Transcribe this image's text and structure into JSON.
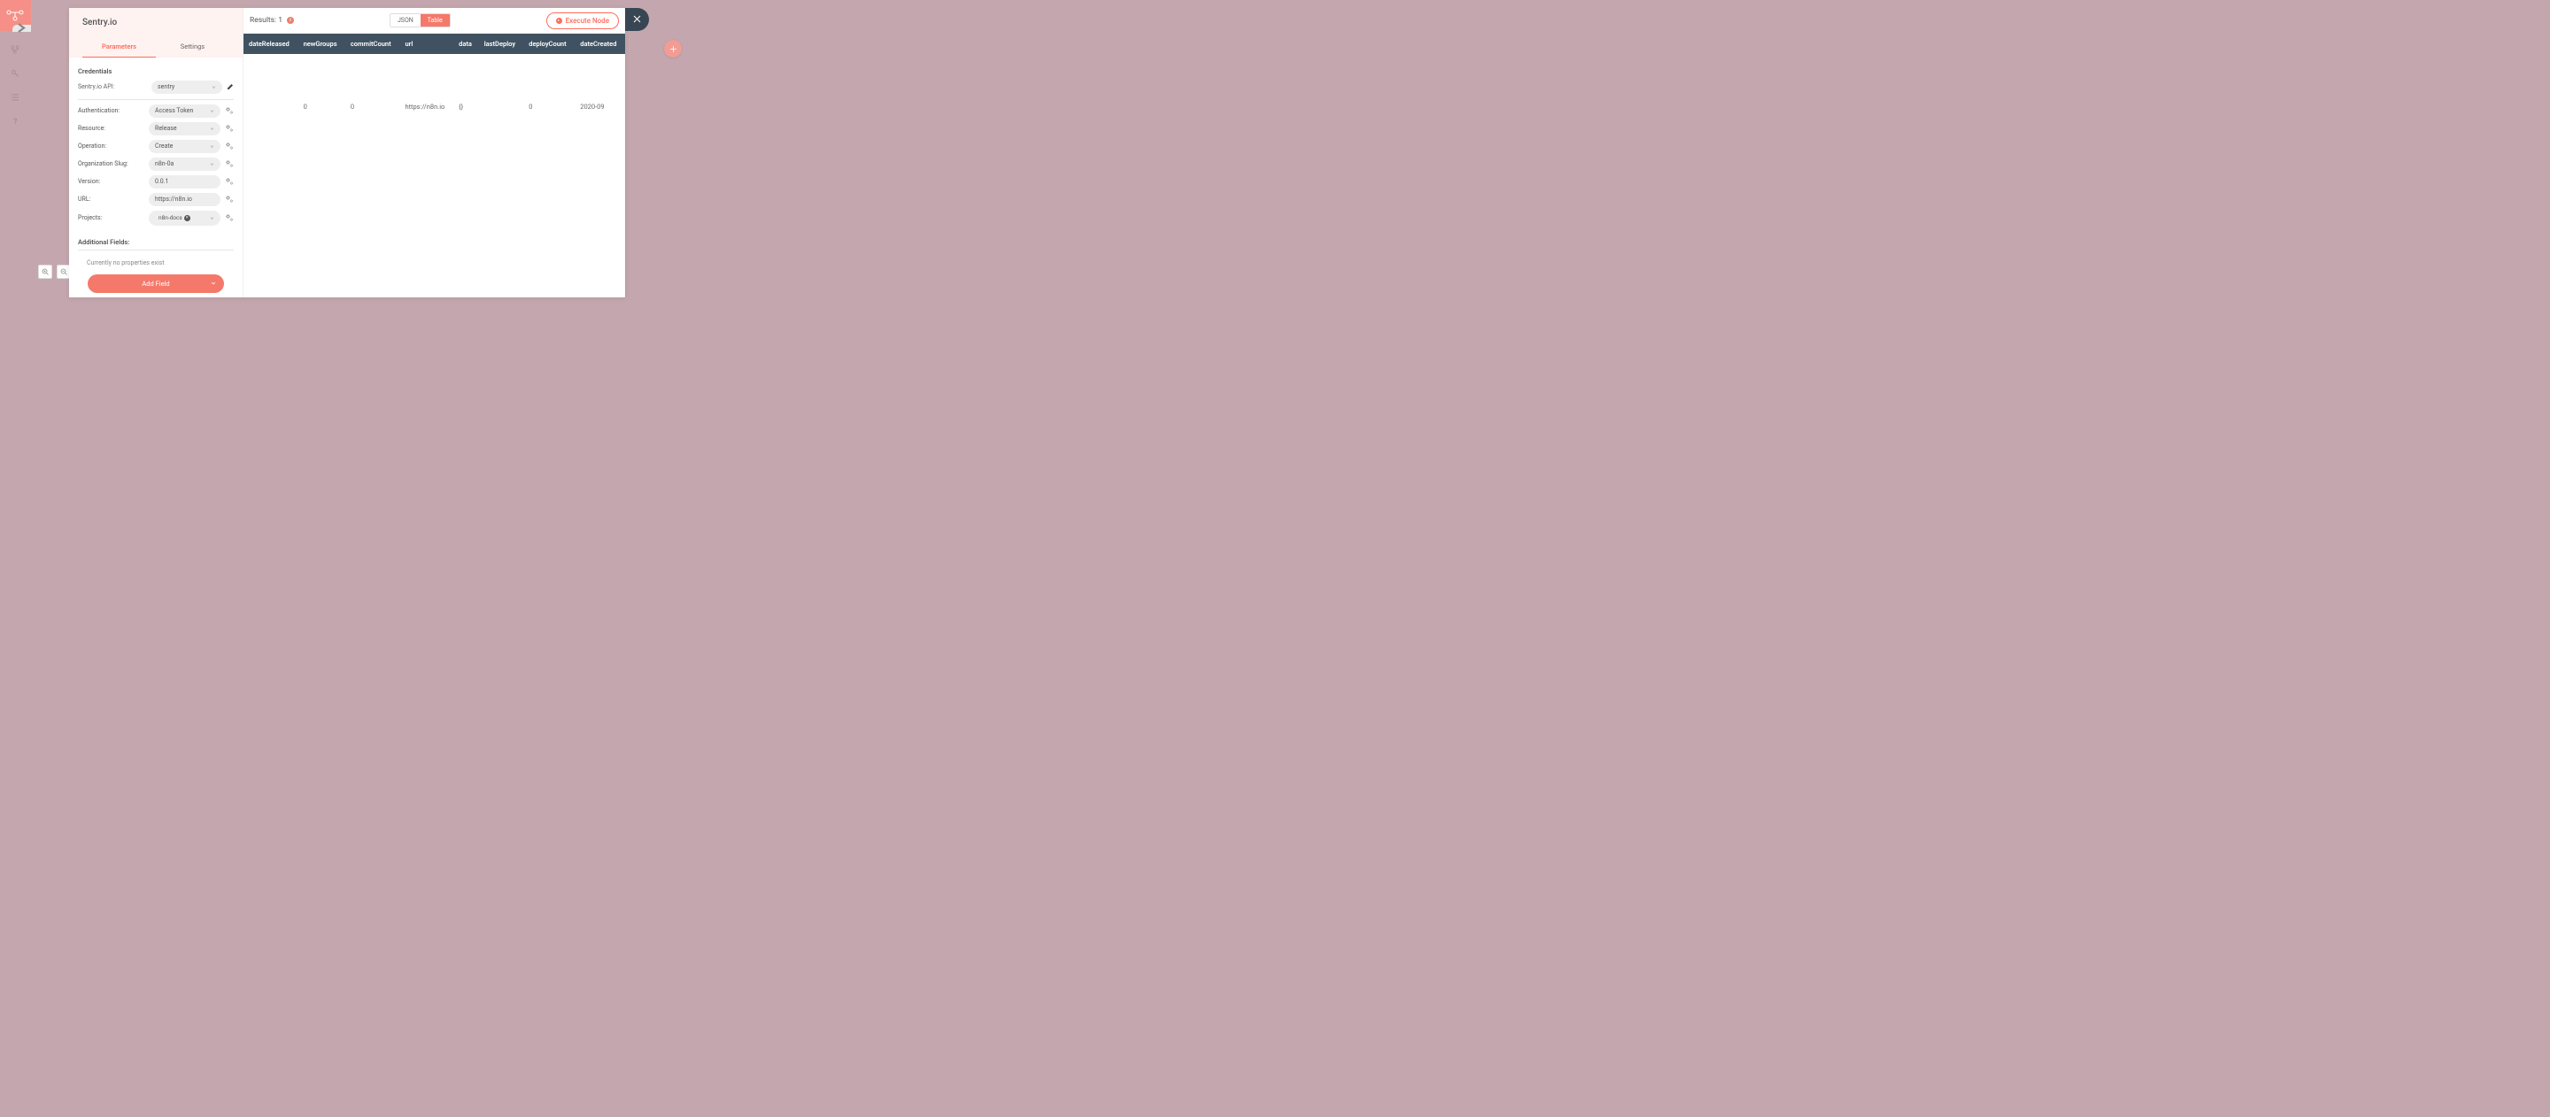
{
  "nodeTitle": "Sentry.io",
  "tabs": {
    "parameters": "Parameters",
    "settings": "Settings"
  },
  "credentials": {
    "sectionLabel": "Credentials",
    "apiLabel": "Sentry.io API:",
    "apiValue": "sentry"
  },
  "params": {
    "authentication": {
      "label": "Authentication:",
      "value": "Access Token"
    },
    "resource": {
      "label": "Resource:",
      "value": "Release"
    },
    "operation": {
      "label": "Operation:",
      "value": "Create"
    },
    "organizationSlug": {
      "label": "Organization Slug:",
      "value": "n8n-0a"
    },
    "version": {
      "label": "Version:",
      "value": "0.0.1"
    },
    "url": {
      "label": "URL:",
      "value": "https://n8n.io"
    },
    "projects": {
      "label": "Projects:",
      "value": "n8n-docs"
    }
  },
  "additional": {
    "title": "Additional Fields:",
    "empty": "Currently no properties exist",
    "addButton": "Add Field"
  },
  "results": {
    "label": "Results: 1",
    "viewJson": "JSON",
    "viewTable": "Table",
    "executeButton": "Execute Node",
    "columns": [
      "dateReleased",
      "newGroups",
      "commitCount",
      "url",
      "data",
      "lastDeploy",
      "deployCount",
      "dateCreated"
    ],
    "row": {
      "dateReleased": "",
      "newGroups": "0",
      "commitCount": "0",
      "url": "https://n8n.io",
      "data": "{}",
      "lastDeploy": "",
      "deployCount": "0",
      "dateCreated": "2020-09"
    }
  }
}
